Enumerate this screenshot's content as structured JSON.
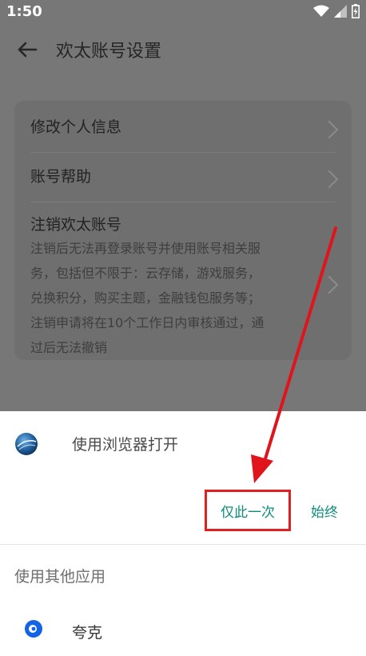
{
  "status_bar": {
    "time": "1:50"
  },
  "app_bar": {
    "title": "欢太账号设置"
  },
  "settings": {
    "items": [
      {
        "label": "修改个人信息"
      },
      {
        "label": "账号帮助"
      },
      {
        "label": "注销欢太账号",
        "description_lines": [
          "注销后无法再登录账号并使用账号相关服",
          "务，包括但不限于：云存储，游戏服务，",
          "兑换积分，购买主题，金融钱包服务等；",
          "注销申请将在10个工作日内审核通过，通",
          "过后无法撤销"
        ]
      }
    ]
  },
  "sheet": {
    "browser_label": "使用浏览器打开",
    "just_once": "仅此一次",
    "always": "始终",
    "other_apps_label": "使用其他应用",
    "quark_label": "夸克"
  },
  "colors": {
    "accent": "#0e8b7c",
    "highlight_box": "#e02020",
    "arrow": "#e0141b"
  }
}
